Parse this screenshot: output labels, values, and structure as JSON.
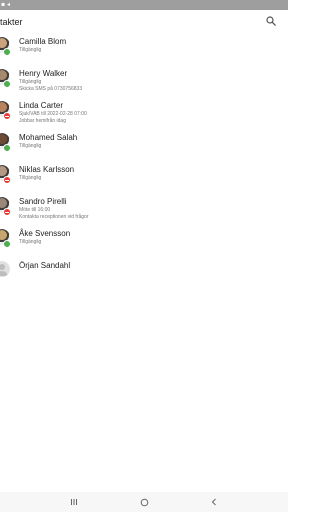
{
  "status_bar": {
    "icons": "▪ ◂"
  },
  "header": {
    "title": "ntakter",
    "search_icon": "search-icon"
  },
  "colors": {
    "available": "#4caf50",
    "busy": "#e53935",
    "accent": "#222222"
  },
  "contacts": [
    {
      "name": "Camilla Blom",
      "lines": [
        "Tillgänglig"
      ],
      "status": "available",
      "avatar_color": "#c9a27e"
    },
    {
      "name": "Henry Walker",
      "lines": [
        "Tillgänglig",
        "Skicka SMS på 0730756833"
      ],
      "status": "available",
      "avatar_color": "#a6896f"
    },
    {
      "name": "Linda Carter",
      "lines": [
        "Sjuk/VAB till 2022-02-28 07:00",
        "Jobbar hemifrån idag"
      ],
      "status": "busy",
      "avatar_color": "#b7845f"
    },
    {
      "name": "Mohamed Salah",
      "lines": [
        "Tillgänglig"
      ],
      "status": "available",
      "avatar_color": "#6d4a36"
    },
    {
      "name": "Niklas Karlsson",
      "lines": [
        "Tillgänglig"
      ],
      "status": "busy",
      "avatar_color": "#b39a86"
    },
    {
      "name": "Sandro Pirelli",
      "lines": [
        "Möte till 16:00",
        "Kontakta receptionen vid frågor"
      ],
      "status": "busy",
      "avatar_color": "#9a8777"
    },
    {
      "name": "Åke Svensson",
      "lines": [
        "Tillgänglig"
      ],
      "status": "available",
      "avatar_color": "#c6a56f"
    },
    {
      "name": "Örjan Sandahl",
      "lines": [],
      "status": "none",
      "avatar_color": "#e0e0e0"
    }
  ],
  "nav": {
    "recents_icon": "recents-icon",
    "home_icon": "home-icon",
    "back_icon": "back-icon"
  }
}
